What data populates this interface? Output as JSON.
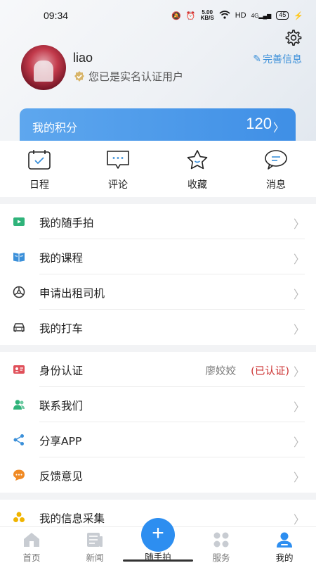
{
  "status_bar": {
    "time": "09:34",
    "speed_value": "5.00",
    "speed_unit": "KB/S",
    "network_label": "HD",
    "signal_label": "4G",
    "battery": "45"
  },
  "profile": {
    "username": "liao",
    "verified_text": "您已是实名认证用户",
    "edit_label": "完善信息"
  },
  "points": {
    "label": "我的积分",
    "value": "120"
  },
  "quick_actions": [
    {
      "label": "日程",
      "icon": "calendar-icon"
    },
    {
      "label": "评论",
      "icon": "comment-icon"
    },
    {
      "label": "收藏",
      "icon": "star-icon"
    },
    {
      "label": "消息",
      "icon": "message-icon"
    }
  ],
  "section1": [
    {
      "label": "我的随手拍",
      "icon": "video-icon",
      "color": "#2fb37a"
    },
    {
      "label": "我的课程",
      "icon": "book-icon",
      "color": "#3a8fd9"
    },
    {
      "label": "申请出租司机",
      "icon": "steering-wheel-icon",
      "color": "#333333"
    },
    {
      "label": "我的打车",
      "icon": "car-icon",
      "color": "#333333"
    }
  ],
  "section2": [
    {
      "label": "身份认证",
      "icon": "id-card-icon",
      "color": "#e0505a",
      "name": "廖姣姣",
      "status": "(已认证)"
    },
    {
      "label": "联系我们",
      "icon": "contacts-icon",
      "color": "#2fb37a"
    },
    {
      "label": "分享APP",
      "icon": "share-icon",
      "color": "#3a8fd9"
    },
    {
      "label": "反馈意见",
      "icon": "feedback-icon",
      "color": "#f08a24"
    }
  ],
  "section3": [
    {
      "label": "我的信息采集",
      "icon": "collect-icon",
      "color": "#f0b400"
    }
  ],
  "bottom_nav": [
    {
      "label": "首页",
      "icon": "home-icon"
    },
    {
      "label": "新闻",
      "icon": "news-icon"
    },
    {
      "label": "随手拍",
      "icon": "plus-icon"
    },
    {
      "label": "服务",
      "icon": "service-icon"
    },
    {
      "label": "我的",
      "icon": "profile-icon"
    }
  ],
  "colors": {
    "accent": "#3a8fd9",
    "points_card": "#4a96ea",
    "verified_status": "#cc3333"
  }
}
